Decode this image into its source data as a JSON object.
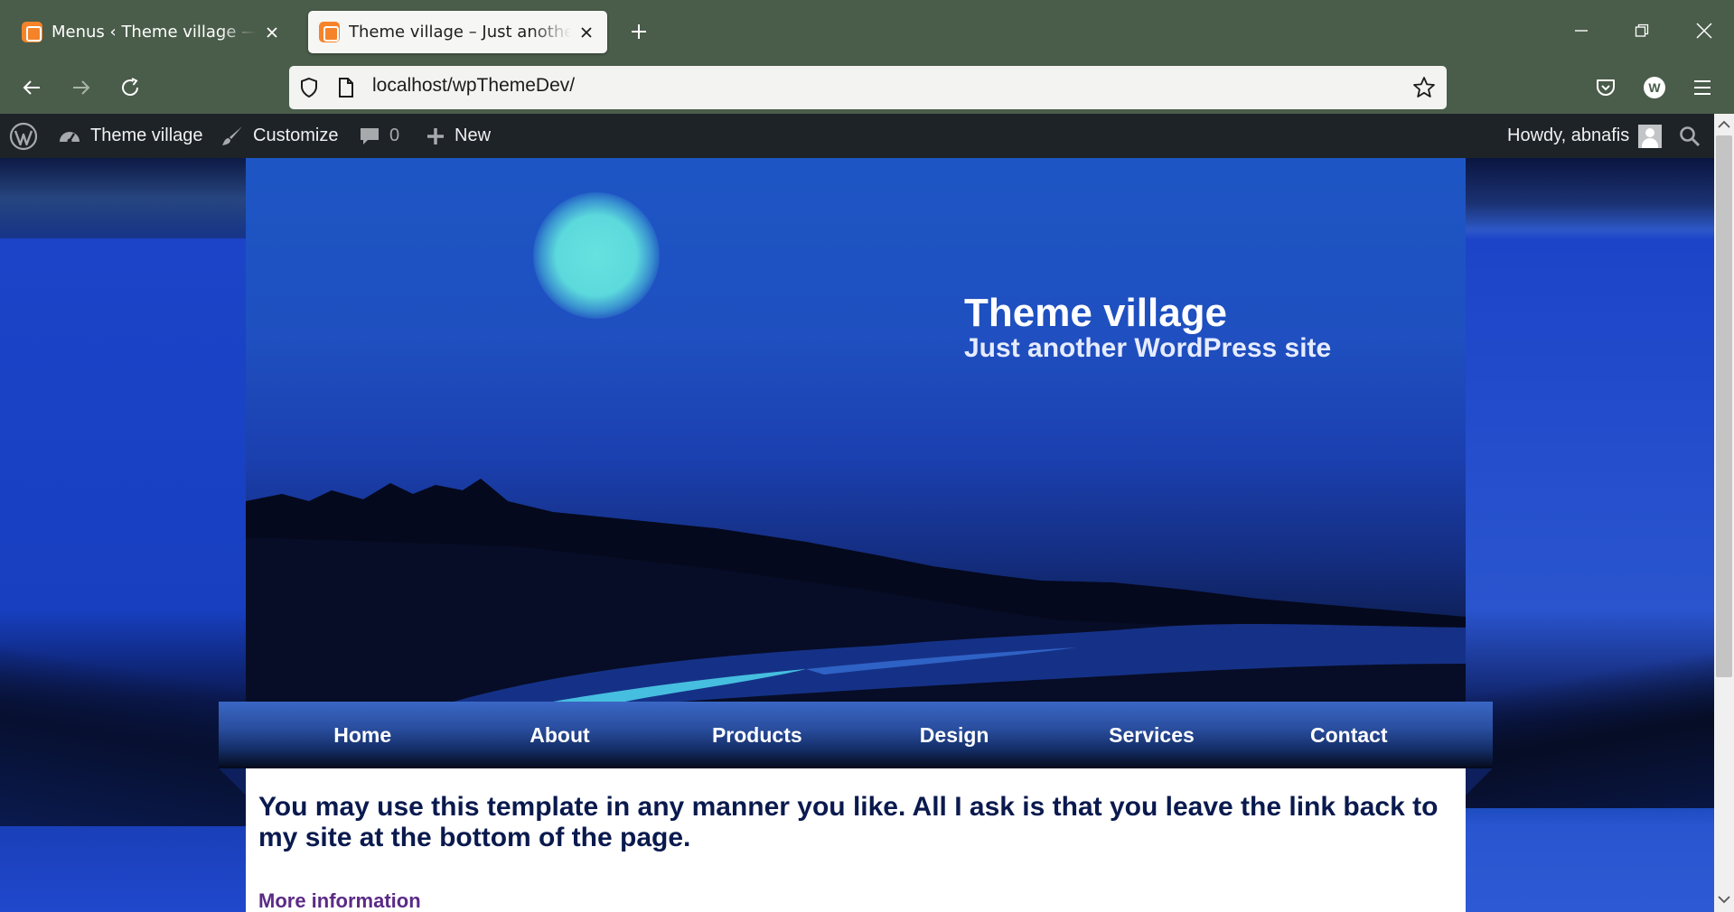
{
  "browser": {
    "tabs": [
      {
        "title": "Menus ‹ Theme village — WordPress",
        "active": false
      },
      {
        "title": "Theme village – Just another WordPress site",
        "active": true
      }
    ],
    "url": "localhost/wpThemeDev/"
  },
  "admin_bar": {
    "site_name": "Theme village",
    "customize_label": "Customize",
    "comments_count": "0",
    "new_label": "New",
    "greeting": "Howdy, abnafis"
  },
  "site": {
    "title": "Theme village",
    "description": "Just another WordPress site"
  },
  "menu": {
    "items": [
      "Home",
      "About",
      "Products",
      "Design",
      "Services",
      "Contact"
    ]
  },
  "content": {
    "heading": "You may use this template in any manner you like. All I ask is that you leave the link back to my site at the bottom of the page.",
    "more_link": "More information"
  },
  "colors": {
    "chrome": "#4a5c4a",
    "admin_bar": "#1e2327",
    "page_bg": "#1a3fb9",
    "heading": "#0a1a4e",
    "link": "#5b2a86"
  }
}
